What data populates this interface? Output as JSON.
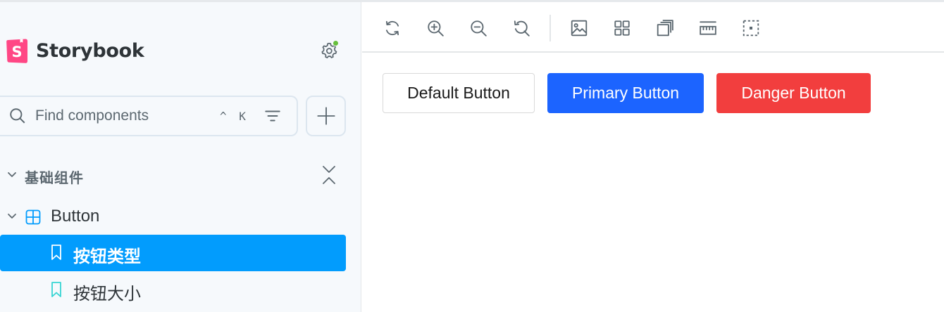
{
  "app": {
    "brand_name": "Storybook",
    "accent_color": "#029cfd",
    "logo_color": "#ff4785",
    "status_dot_color": "#66bf3c"
  },
  "sidebar": {
    "search": {
      "placeholder": "Find components",
      "shortcut": "^ K"
    },
    "group": {
      "label": "基础组件",
      "expanded": true
    },
    "component": {
      "label": "Button",
      "expanded": true
    },
    "stories": [
      {
        "label": "按钮类型",
        "selected": true
      },
      {
        "label": "按钮大小",
        "selected": false
      }
    ]
  },
  "toolbar": {
    "tools": [
      {
        "name": "remount-icon"
      },
      {
        "name": "zoom-in-icon"
      },
      {
        "name": "zoom-out-icon"
      },
      {
        "name": "zoom-reset-icon"
      },
      {
        "name": "background-icon"
      },
      {
        "name": "grid-icon"
      },
      {
        "name": "viewport-icon"
      },
      {
        "name": "measure-icon"
      },
      {
        "name": "outline-icon"
      }
    ]
  },
  "canvas": {
    "buttons": [
      {
        "label": "Default Button",
        "variant": "default",
        "color": "#ffffff"
      },
      {
        "label": "Primary Button",
        "variant": "primary",
        "color": "#1c64ff"
      },
      {
        "label": "Danger Button",
        "variant": "danger",
        "color": "#f23e3e"
      }
    ]
  }
}
